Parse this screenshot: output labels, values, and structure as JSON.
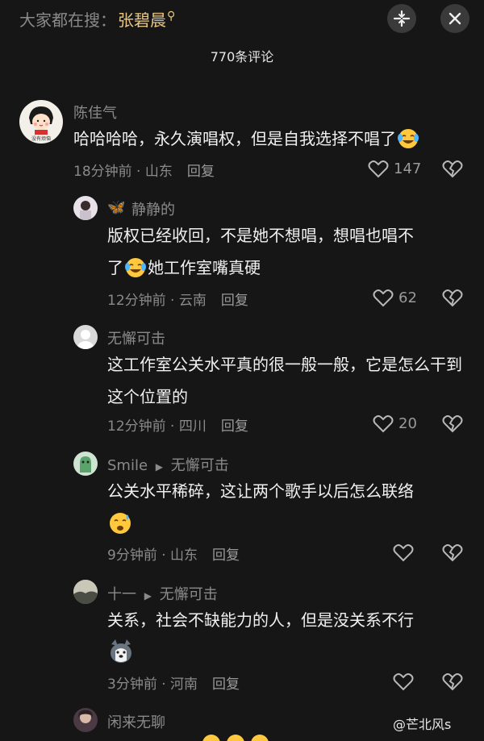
{
  "header": {
    "search_prefix": "大家都在搜：",
    "search_keyword": "张碧晨",
    "comment_count": "770条评论"
  },
  "comments": [
    {
      "user": "陈佳气",
      "text": "哈哈哈哈，永久演唱权，但是自我选择不唱了",
      "time": "18分钟前",
      "location": "山东",
      "reply": "回复",
      "likes": "147",
      "avatar_text": "没有烦恼"
    },
    {
      "user": "静静的",
      "text_a": "版权已经收回，不是她不想唱，想唱也唱不",
      "text_b": "了",
      "text_c": "她工作室嘴真硬",
      "time": "12分钟前",
      "location": "云南",
      "reply": "回复",
      "likes": "62"
    },
    {
      "user": "无懈可击",
      "text": "这工作室公关水平真的很一般一般，它是怎么干到这个位置的",
      "time": "12分钟前",
      "location": "四川",
      "reply": "回复",
      "likes": "20"
    },
    {
      "user": "Smile",
      "reply_to": "无懈可击",
      "text": "公关水平稀碎，这让两个歌手以后怎么联络",
      "time": "9分钟前",
      "location": "山东",
      "reply": "回复",
      "likes": ""
    },
    {
      "user": "十一",
      "reply_to": "无懈可击",
      "text": "关系，社会不缺能力的人，但是没关系不行",
      "time": "3分钟前",
      "location": "河南",
      "reply": "回复",
      "likes": ""
    },
    {
      "user": "闲来无聊",
      "text": ""
    }
  ],
  "watermark": "@芒北风s",
  "colors": {
    "background": "#161616",
    "keyword": "#e9c886",
    "muted": "#8a8a8a"
  }
}
